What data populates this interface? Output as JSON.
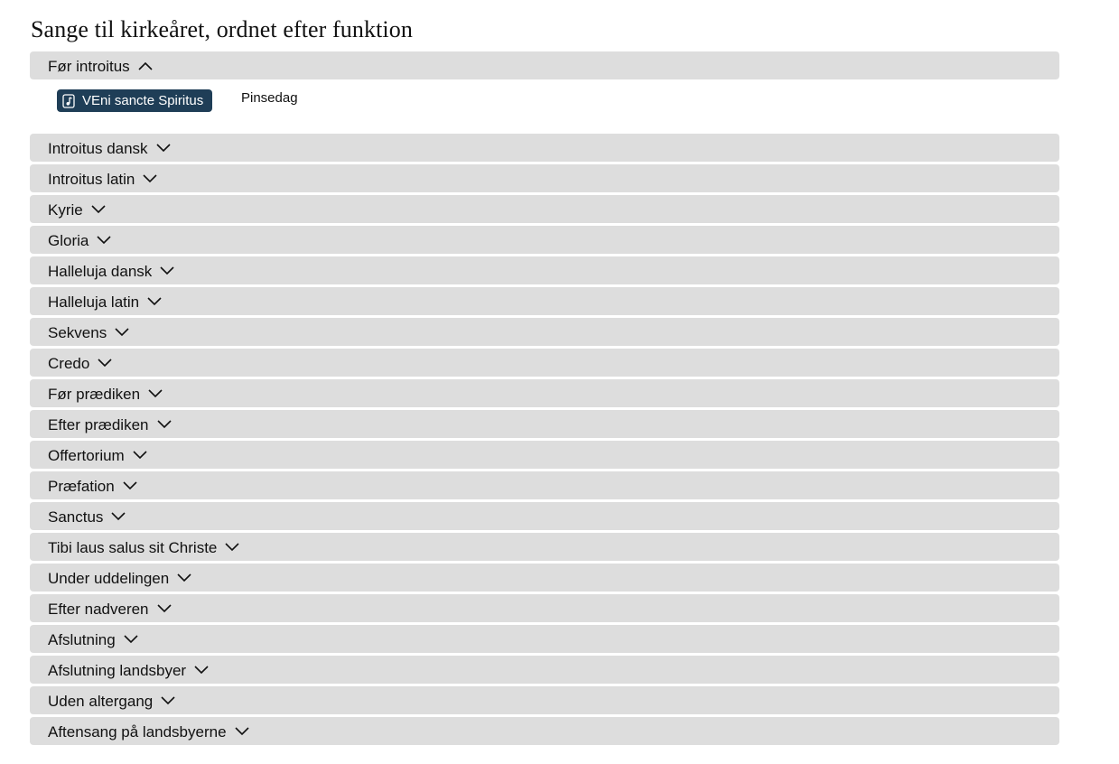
{
  "page": {
    "title": "Sange til kirkeåret, ordnet efter funktion"
  },
  "sections": [
    {
      "label": "Før introitus",
      "expanded": true,
      "songs": [
        {
          "title": "VEni sancte Spiritus",
          "occasion": "Pinsedag",
          "icon": "music-note-icon"
        }
      ]
    },
    {
      "label": "Introitus dansk",
      "expanded": false
    },
    {
      "label": "Introitus latin",
      "expanded": false
    },
    {
      "label": "Kyrie",
      "expanded": false
    },
    {
      "label": "Gloria",
      "expanded": false
    },
    {
      "label": "Halleluja dansk",
      "expanded": false
    },
    {
      "label": "Halleluja latin",
      "expanded": false
    },
    {
      "label": "Sekvens",
      "expanded": false
    },
    {
      "label": "Credo",
      "expanded": false
    },
    {
      "label": "Før prædiken",
      "expanded": false
    },
    {
      "label": "Efter prædiken",
      "expanded": false
    },
    {
      "label": "Offertorium",
      "expanded": false
    },
    {
      "label": "Præfation",
      "expanded": false
    },
    {
      "label": "Sanctus",
      "expanded": false
    },
    {
      "label": "Tibi laus salus sit Christe",
      "expanded": false
    },
    {
      "label": "Under uddelingen",
      "expanded": false
    },
    {
      "label": "Efter nadveren",
      "expanded": false
    },
    {
      "label": "Afslutning",
      "expanded": false
    },
    {
      "label": "Afslutning landsbyer",
      "expanded": false
    },
    {
      "label": "Uden altergang",
      "expanded": false
    },
    {
      "label": "Aftensang på landsbyerne",
      "expanded": false
    }
  ],
  "colors": {
    "header_bg": "#dddddd",
    "button_bg": "#1f3e57",
    "button_text": "#ffffff"
  }
}
